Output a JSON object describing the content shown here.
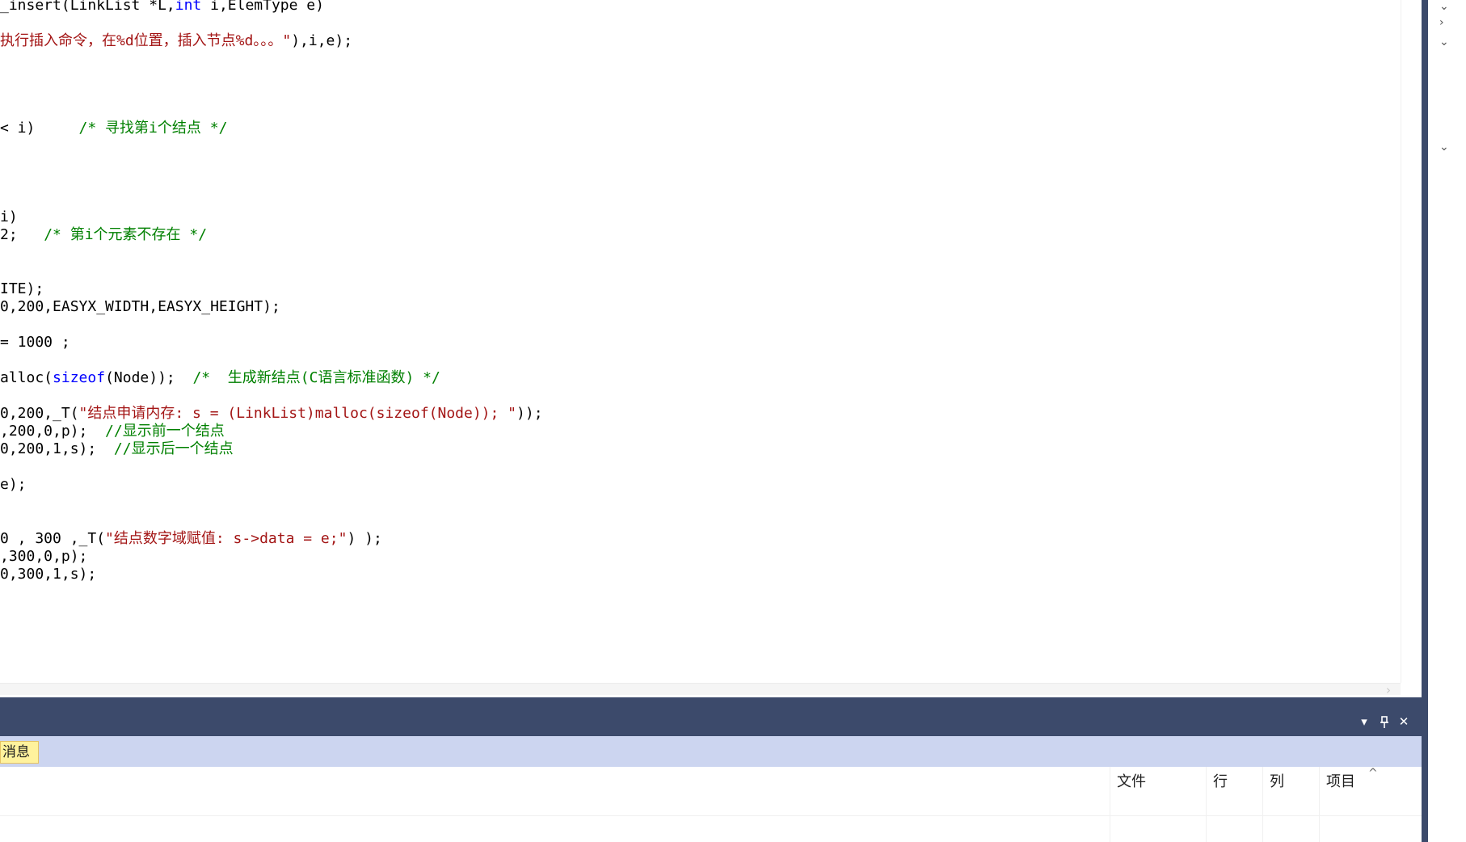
{
  "editor": {
    "lines": [
      [
        {
          "t": "_insert(LinkList *L,",
          "c": "tx"
        },
        {
          "t": "int",
          "c": "kw"
        },
        {
          "t": " i,ElemType e)",
          "c": "tx"
        }
      ],
      [
        {
          "t": "执行插入命令，在%d位置，插入节点%d。。。\"",
          "c": "str"
        },
        {
          "t": "),i,e);",
          "c": "tx"
        }
      ],
      [
        {
          "t": "< i)     ",
          "c": "tx"
        },
        {
          "t": "/* 寻找第i个结点 */",
          "c": "cm"
        }
      ],
      [
        {
          "t": "i)",
          "c": "tx"
        }
      ],
      [
        {
          "t": "2;   ",
          "c": "tx"
        },
        {
          "t": "/* 第i个元素不存在 */",
          "c": "cm"
        }
      ],
      [
        {
          "t": "ITE);",
          "c": "tx"
        }
      ],
      [
        {
          "t": "0,200,EASYX_WIDTH,EASYX_HEIGHT);",
          "c": "tx"
        }
      ],
      [
        {
          "t": "= 1000 ;",
          "c": "tx"
        }
      ],
      [
        {
          "t": "alloc(",
          "c": "tx"
        },
        {
          "t": "sizeof",
          "c": "kw"
        },
        {
          "t": "(Node));  ",
          "c": "tx"
        },
        {
          "t": "/*  生成新结点(C语言标准函数) */",
          "c": "cm"
        }
      ],
      [
        {
          "t": "0,200,_T(",
          "c": "tx"
        },
        {
          "t": "\"结点申请内存: s = (LinkList)malloc(sizeof(Node)); \"",
          "c": "str"
        },
        {
          "t": "));",
          "c": "tx"
        }
      ],
      [
        {
          "t": ",200,0,p);  ",
          "c": "tx"
        },
        {
          "t": "//显示前一个结点",
          "c": "cm"
        }
      ],
      [
        {
          "t": "0,200,1,s);  ",
          "c": "tx"
        },
        {
          "t": "//显示后一个结点",
          "c": "cm"
        }
      ],
      [
        {
          "t": "e);",
          "c": "tx"
        }
      ],
      [
        {
          "t": "0 , 300 ,_T(",
          "c": "tx"
        },
        {
          "t": "\"结点数字域赋值: s->data = e;\"",
          "c": "str"
        },
        {
          "t": ") );",
          "c": "tx"
        }
      ],
      [
        {
          "t": ",300,0,p);",
          "c": "tx"
        }
      ],
      [
        {
          "t": "0,300,1,s);",
          "c": "tx"
        }
      ]
    ]
  },
  "scrollbar": {
    "up_glyph": "︿",
    "down_glyph": "﹀",
    "right_glyph": "›"
  },
  "right_panel": {
    "glyphs": [
      "⌄",
      "›",
      "⌄",
      "⌄"
    ]
  },
  "panel": {
    "title_buttons": {
      "dropdown": "▾",
      "pin": "📌",
      "close": "✕"
    },
    "tab_label": "消息",
    "columns": [
      "文件",
      "行",
      "列",
      "项目"
    ],
    "sort_glyph": "^"
  },
  "colors": {
    "string": "#a31515",
    "keyword": "#0000ff",
    "comment": "#008000",
    "chrome_dark": "#3c4a6b",
    "tab_strip": "#ccd5f0",
    "active_tab": "#fff29d"
  }
}
